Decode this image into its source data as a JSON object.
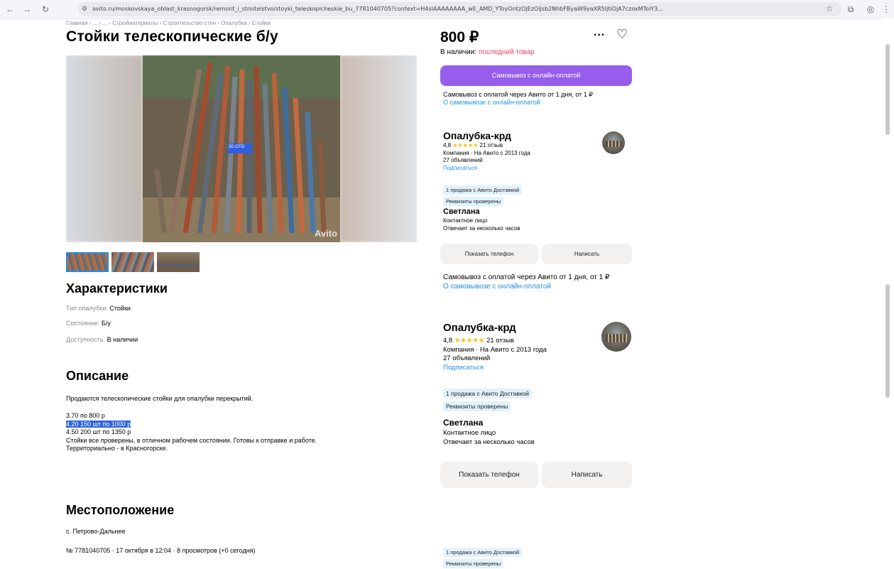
{
  "browser": {
    "url": "avito.ru/moskovskaya_oblast_krasnogorsk/remont_i_stroitelstvo/stoyki_teleskopicheskie_bu_7781040705?context=H4sIAAAAAAAA_wE_AMD_YToyOntzOjEzOiJsb2NhbFByaW9yaXR5IjtiOjA7czoxMToiY3...",
    "back_icon": "arrow-left-icon",
    "forward_icon": "arrow-right-icon",
    "reload_icon": "reload-icon",
    "bookmark_icon": "star-icon",
    "extensions_icon": "puzzle-icon",
    "profile_icon": "profile-icon",
    "menu_icon": "kebab-menu-icon"
  },
  "breadcrumb": "Главная › ... › ... › Стройматериалы › Строительство стен › Опалубка › Стойки",
  "title": "Стойки телескопические б/у",
  "photo": {
    "badge": "3D.ОТО",
    "watermark": "Avito"
  },
  "characteristics": {
    "heading": "Характеристики",
    "items": [
      {
        "label": "Тип опалубки:",
        "value": "Стойки"
      },
      {
        "label": "Состояние:",
        "value": "Б/у"
      },
      {
        "label": "Доступность:",
        "value": "В наличии"
      }
    ]
  },
  "description": {
    "heading": "Описание",
    "intro": "Продаются телескопические стойки для опалубки перекрытий.",
    "line1": "3.70 по 800 р",
    "line2_highlighted": "4.20 150 шт по 1000 р",
    "line3": "4.50 200 шт по 1350 р",
    "body": "Стойки все проверены, в отличном рабочем состоянии. Готовы к отправке и работе.",
    "location_note": "Территориально - в Красногорске."
  },
  "location": {
    "heading": "Местоположение",
    "address": "с. Петрово-Дальнее",
    "meta": "№ 7781040705 · 17 октября в 12:04 · 8 просмотров (+0 сегодня)"
  },
  "sidebar": {
    "price": "800 ₽",
    "more_icon": "ellipsis-icon",
    "fav_icon": "heart-icon",
    "availability_prefix": "В наличии:",
    "availability_value": "последний товар",
    "pickup_button": "Самовывоз с онлайн-оплатой",
    "pickup_text": "Самовывоз с оплатой через Авито от 1 дня, от 1 ₽",
    "pickup_link": "О самовывозе с онлайн-оплатой",
    "seller": {
      "name": "Опалубка-крд",
      "rating": "4,8",
      "stars": "★★★★★",
      "reviews": "21 отзыв",
      "company": "Компания · На Авито с 2013 года",
      "listings": "27 объявлений",
      "subscribe": "Подписаться",
      "chip_delivery": "1 продажа с Авито Доставкой",
      "chip_verified": "Реквизиты проверены"
    },
    "contact": {
      "name": "Светлана",
      "role": "Контактное лицо",
      "response": "Отвечает за несколько часов"
    },
    "show_phone": "Показать телефон",
    "write": "Написать",
    "colors": {
      "accent": "#965eeb",
      "link": "#1e90e6",
      "red": "#ff3b4e",
      "chip": "#e1f2fc"
    }
  }
}
